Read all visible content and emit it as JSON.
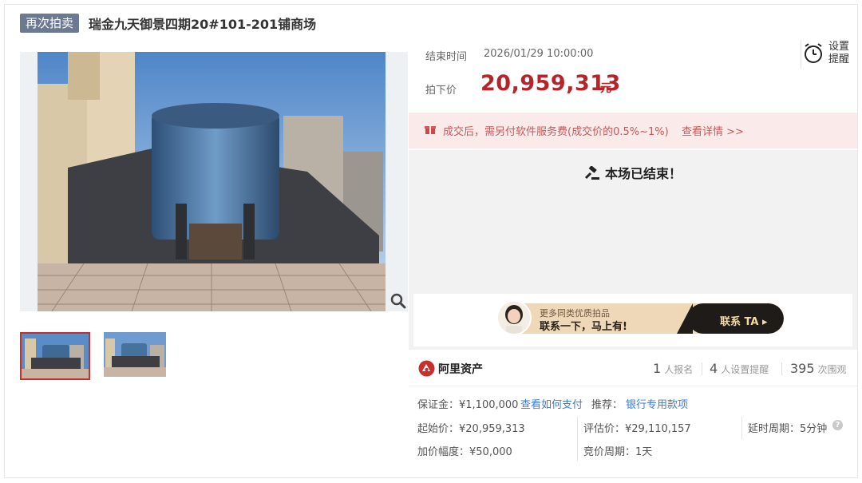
{
  "header": {
    "tag": "再次拍卖",
    "title": "瑞金九天御景四期20#101-201铺商场"
  },
  "auction": {
    "end_time_label": "结束时间",
    "end_time_value": "2026/01/29 10:00:00",
    "price_label": "拍下价",
    "price_value": "20,959,313",
    "price_unit": "元",
    "remind_label": "设置提醒"
  },
  "fee": {
    "text": "成交后，需另付软件服务费(成交价的0.5%~1%)",
    "link": "查看详情 >>"
  },
  "status": {
    "ended_text": "本场已结束！"
  },
  "banner": {
    "line1": "更多同类优质拍品",
    "line2": "联系一下，马上有!",
    "cta": "联系 TA ▸"
  },
  "platform": {
    "name": "阿里资产"
  },
  "stats": {
    "signup_count": "1",
    "signup_label": "人报名",
    "remind_count": "4",
    "remind_label": "人设置提醒",
    "view_count": "395",
    "view_label": "次围观"
  },
  "details": {
    "deposit": "保证金：¥1,100,000",
    "how_to_pay": "查看如何支付",
    "recommend_label": "推荐：",
    "recommend_link": "银行专用款项",
    "start_price": "起始价：¥20,959,313",
    "appraisal": "评估价：¥29,110,157",
    "delay_period": "延时周期：5分钟",
    "increment": "加价幅度：¥50,000",
    "bid_period": "竞价周期：1天"
  },
  "icons": {
    "zoom": "zoom-icon",
    "alarm": "alarm-clock-icon",
    "fee": "gift-icon",
    "gavel": "gavel-icon",
    "help": "question-icon",
    "logo": "ali-asset-logo"
  },
  "colors": {
    "accent_red": "#b6242a",
    "tag_bg": "#6b7a90",
    "fee_bg": "#fbeaea",
    "link_blue": "#3c7bd8"
  }
}
